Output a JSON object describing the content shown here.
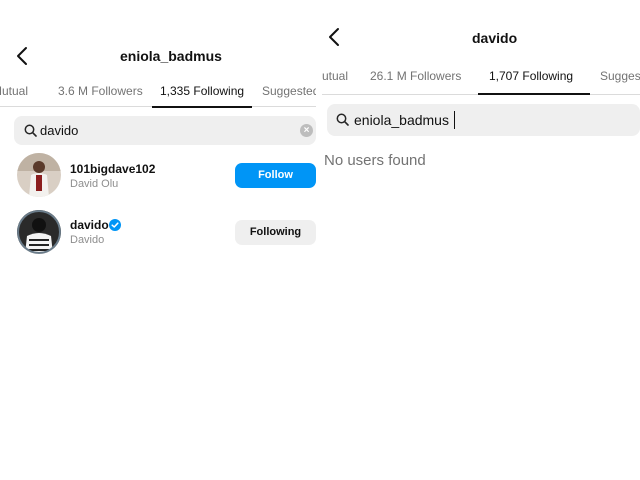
{
  "left": {
    "title": "eniola_badmus",
    "tabs": [
      {
        "label": "Mutual"
      },
      {
        "label": "3.6 M Followers"
      },
      {
        "label": "1,335 Following"
      },
      {
        "label": "Suggested"
      }
    ],
    "active_tab": 2,
    "search": {
      "value": "davido"
    },
    "users": [
      {
        "username": "101bigdave102",
        "fullname": "David Olu",
        "button": "Follow",
        "verified": false
      },
      {
        "username": "davido",
        "fullname": "Davido",
        "button": "Following",
        "verified": true
      }
    ]
  },
  "right": {
    "title": "davido",
    "tabs": [
      {
        "label": "Mutual"
      },
      {
        "label": "26.1 M Followers"
      },
      {
        "label": "1,707 Following"
      },
      {
        "label": "Suggested"
      }
    ],
    "active_tab": 2,
    "search": {
      "value": "eniola_badmus"
    },
    "empty_message": "No users found"
  },
  "colors": {
    "follow_button": "#0095f6",
    "following_button": "#efefef",
    "verified_badge": "#0095f6"
  },
  "icons": [
    "back-arrow-icon",
    "search-icon",
    "clear-icon",
    "verified-badge-icon"
  ]
}
